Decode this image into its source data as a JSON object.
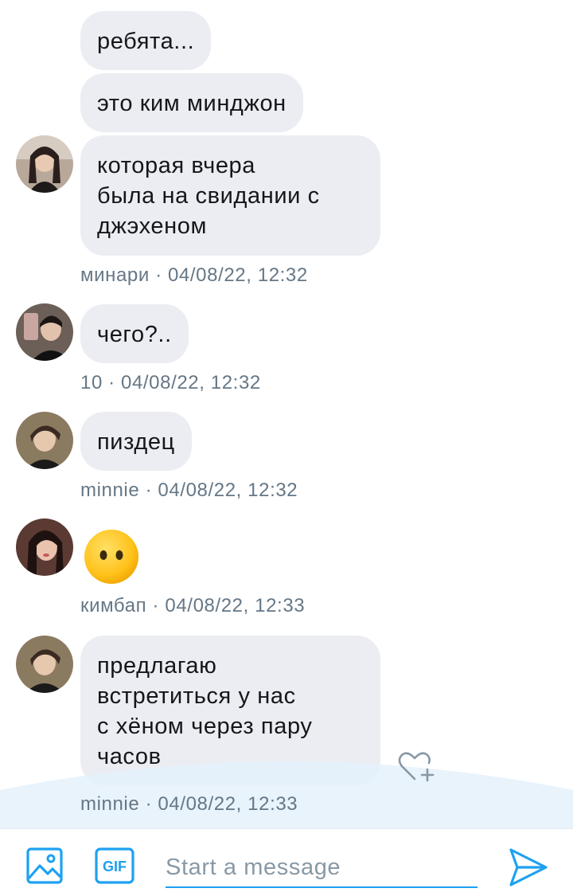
{
  "messages": [
    {
      "text": "ребята..."
    },
    {
      "text": "это ким минджон"
    },
    {
      "text": "которая вчера\nбыла на свидании с\nджэхеном",
      "meta": "минари · 04/08/22, 12:32"
    },
    {
      "text": "чего?..",
      "meta": "10 · 04/08/22, 12:32"
    },
    {
      "text": "пиздец",
      "meta": "minnie · 04/08/22, 12:32"
    },
    {
      "emoji": "face-without-mouth-emoji",
      "meta": "кимбап · 04/08/22, 12:33"
    },
    {
      "text": "предлагаю\nвстретиться у нас\nс хёном через пару\nчасов",
      "meta": "minnie · 04/08/22, 12:33"
    }
  ],
  "composer": {
    "placeholder": "Start a message",
    "gif_label": "GIF",
    "icons": [
      "image-icon",
      "gif-icon",
      "send-icon"
    ]
  },
  "reaction_icon": "heart-plus-icon",
  "colors": {
    "bubble": "#ebedf2",
    "meta_text": "#657786",
    "accent": "#1da1f2",
    "wave": "#e4f1fc"
  }
}
